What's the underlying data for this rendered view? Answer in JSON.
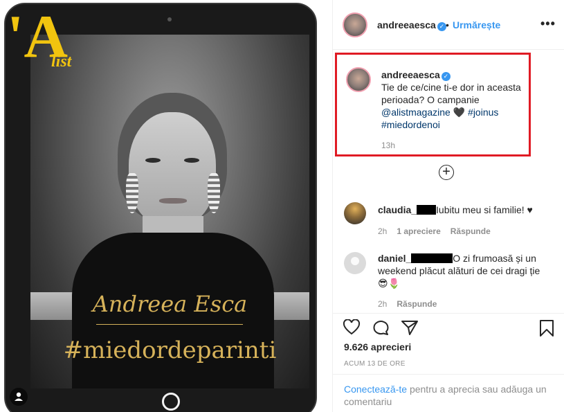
{
  "post": {
    "logo_big": "'A",
    "logo_small": "list",
    "signature": "Andreea Esca",
    "hashtag_title": "#miedordeparinti"
  },
  "header": {
    "username": "andreeaesca",
    "dot": "•",
    "follow_label": "Urmărește",
    "more_label": "•••"
  },
  "caption": {
    "username": "andreeaesca",
    "text_part1": "Tie de ce/cine ti-e dor in aceasta perioada? O campanie ",
    "mention": "@alistmagazine",
    "emoji": " 🖤 ",
    "hashtag1": "#joinus",
    "hashtag2": "#miedordenoi",
    "time": "13h"
  },
  "load_more_label": "+",
  "comments": [
    {
      "username": "claudia_",
      "text": "Iubitu meu si familie! ♥",
      "time": "2h",
      "likes": "1 apreciere",
      "reply": "Răspunde"
    },
    {
      "username": "daniel_",
      "text": "O zi frumoasă și un weekend plăcut alături de cei dragi ție 😎🌷",
      "time": "2h",
      "reply": "Răspunde"
    }
  ],
  "stats": {
    "likes": "9.626 aprecieri",
    "posted": "ACUM 13 DE ORE"
  },
  "login": {
    "link": "Conectează-te",
    "text": " pentru a aprecia sau adăuga un comentariu"
  },
  "colors": {
    "accent": "#3897f0",
    "highlight_border": "#e01b24",
    "gold": "#d6b25a",
    "logo_yellow": "#f1c40f"
  }
}
